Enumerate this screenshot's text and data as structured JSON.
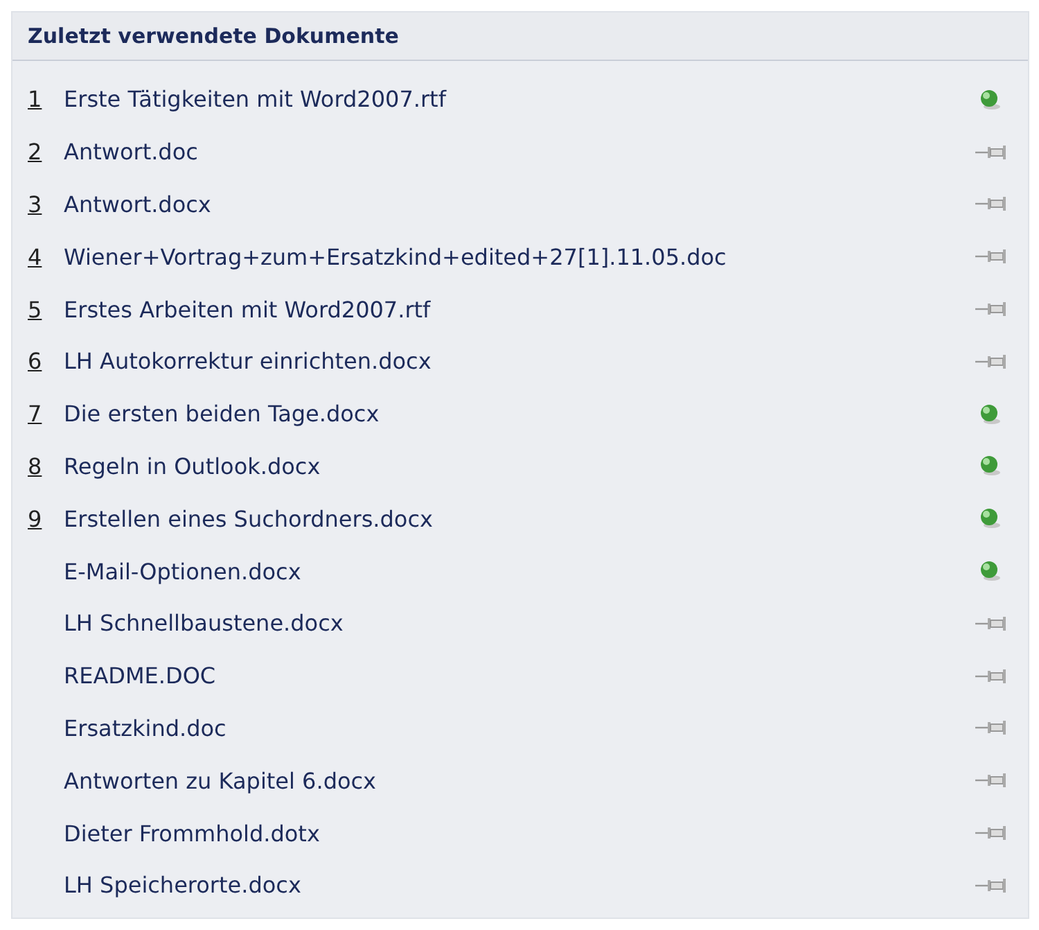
{
  "panel": {
    "title": "Zuletzt verwendete Dokumente"
  },
  "documents": [
    {
      "number": "1",
      "name": "Erste Tätigkeiten mit Word2007.rtf",
      "pinned": true
    },
    {
      "number": "2",
      "name": "Antwort.doc",
      "pinned": false
    },
    {
      "number": "3",
      "name": "Antwort.docx",
      "pinned": false
    },
    {
      "number": "4",
      "name": "Wiener+Vortrag+zum+Ersatzkind+edited+27[1].11.05.doc",
      "pinned": false
    },
    {
      "number": "5",
      "name": "Erstes Arbeiten mit Word2007.rtf",
      "pinned": false
    },
    {
      "number": "6",
      "name": "LH Autokorrektur einrichten.docx",
      "pinned": false
    },
    {
      "number": "7",
      "name": "Die ersten beiden Tage.docx",
      "pinned": true
    },
    {
      "number": "8",
      "name": "Regeln in Outlook.docx",
      "pinned": true
    },
    {
      "number": "9",
      "name": "Erstellen eines Suchordners.docx",
      "pinned": true
    },
    {
      "name": "E-Mail-Optionen.docx",
      "pinned": true
    },
    {
      "name": "LH Schnellbaustene.docx",
      "pinned": false
    },
    {
      "name": "README.DOC",
      "pinned": false
    },
    {
      "name": "Ersatzkind.doc",
      "pinned": false
    },
    {
      "name": "Antworten zu Kapitel 6.docx",
      "pinned": false
    },
    {
      "name": "Dieter Frommhold.dotx",
      "pinned": false
    },
    {
      "name": "LH Speicherorte.docx",
      "pinned": false
    }
  ]
}
